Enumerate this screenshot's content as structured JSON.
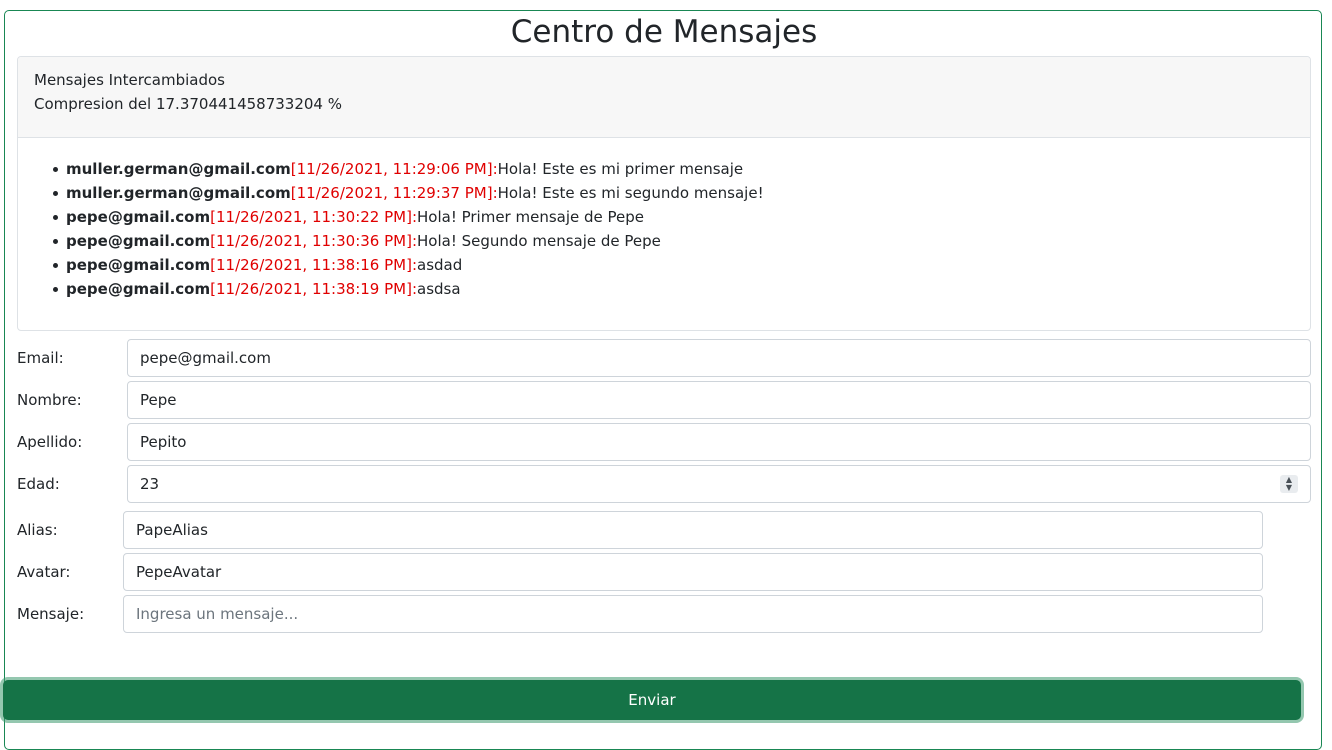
{
  "header": {
    "title": "Centro de Mensajes"
  },
  "stats": {
    "heading": "Mensajes Intercambiados",
    "compression": "Compresion del 17.370441458733204 %"
  },
  "messages": [
    {
      "email": "muller.german@gmail.com",
      "date": "[11/26/2021, 11:29:06 PM]:",
      "text": "Hola! Este es mi primer mensaje"
    },
    {
      "email": "muller.german@gmail.com",
      "date": "[11/26/2021, 11:29:37 PM]:",
      "text": "Hola! Este es mi segundo mensaje!"
    },
    {
      "email": "pepe@gmail.com",
      "date": "[11/26/2021, 11:30:22 PM]:",
      "text": "Hola! Primer mensaje de Pepe"
    },
    {
      "email": "pepe@gmail.com",
      "date": "[11/26/2021, 11:30:36 PM]:",
      "text": "Hola! Segundo mensaje de Pepe"
    },
    {
      "email": "pepe@gmail.com",
      "date": "[11/26/2021, 11:38:16 PM]:",
      "text": "asdad"
    },
    {
      "email": "pepe@gmail.com",
      "date": "[11/26/2021, 11:38:19 PM]:",
      "text": "asdsa"
    }
  ],
  "form": {
    "email": {
      "label": "Email:",
      "value": "pepe@gmail.com"
    },
    "nombre": {
      "label": "Nombre:",
      "value": "Pepe"
    },
    "apellido": {
      "label": "Apellido:",
      "value": "Pepito"
    },
    "edad": {
      "label": "Edad:",
      "value": "23"
    },
    "alias": {
      "label": "Alias:",
      "value": "PapeAlias"
    },
    "avatar": {
      "label": "Avatar:",
      "value": "PepeAvatar"
    },
    "mensaje": {
      "label": "Mensaje:",
      "value": "",
      "placeholder": "Ingresa un mensaje..."
    },
    "submit_label": "Enviar"
  },
  "icons": {
    "spinner": "number-spinner-icon"
  },
  "colors": {
    "accent": "#157347",
    "date": "#e00000"
  }
}
